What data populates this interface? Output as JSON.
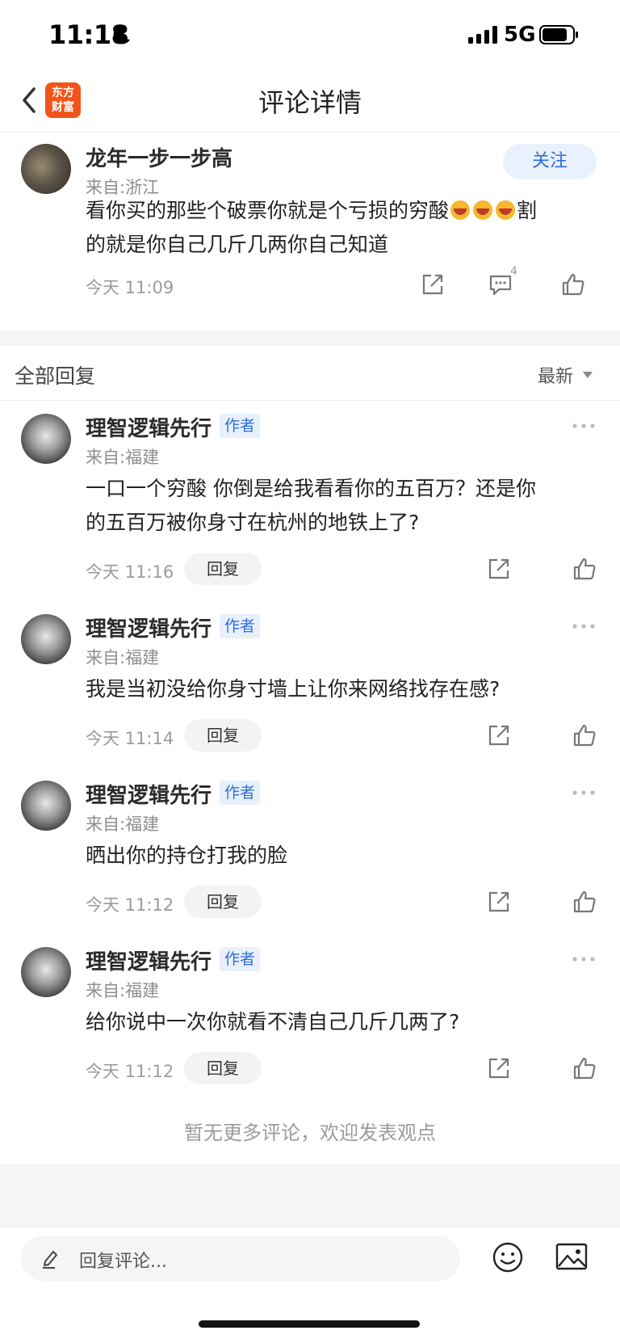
{
  "status_bar": {
    "time": "11:18",
    "network": "5G"
  },
  "nav": {
    "title": "评论详情",
    "logo_line1": "东方",
    "logo_line2": "财富"
  },
  "main_comment": {
    "username": "龙年一步一步高",
    "location": "来自:浙江",
    "follow_label": "关注",
    "text_line1": "看你买的那些个破票你就是个亏损的穷酸",
    "text_line1_end": "割",
    "text_line2": "的就是你自己几斤几两你自己知道",
    "time": "今天 11:09",
    "comment_count": "4"
  },
  "replies_header": {
    "title": "全部回复",
    "sort": "最新"
  },
  "replies": [
    {
      "username": "理智逻辑先行",
      "badge": "作者",
      "location": "来自:福建",
      "text_line1": "一口一个穷酸 你倒是给我看看你的五百万？还是你",
      "text_line2": "的五百万被你身寸在杭州的地铁上了?",
      "time": "今天 11:16",
      "reply_label": "回复"
    },
    {
      "username": "理智逻辑先行",
      "badge": "作者",
      "location": "来自:福建",
      "text_line1": "我是当初没给你身寸墙上让你来网络找存在感?",
      "time": "今天 11:14",
      "reply_label": "回复"
    },
    {
      "username": "理智逻辑先行",
      "badge": "作者",
      "location": "来自:福建",
      "text_line1": "晒出你的持仓打我的脸",
      "time": "今天 11:12",
      "reply_label": "回复"
    },
    {
      "username": "理智逻辑先行",
      "badge": "作者",
      "location": "来自:福建",
      "text_line1": "给你说中一次你就看不清自己几斤几两了?",
      "time": "今天 11:12",
      "reply_label": "回复"
    }
  ],
  "footer_note": "暂无更多评论，欢迎发表观点",
  "input": {
    "placeholder": "回复评论..."
  },
  "colors": {
    "accent": "#2f6fdb",
    "logo": "#f2541a",
    "follow_bg": "#e9f1fc"
  }
}
